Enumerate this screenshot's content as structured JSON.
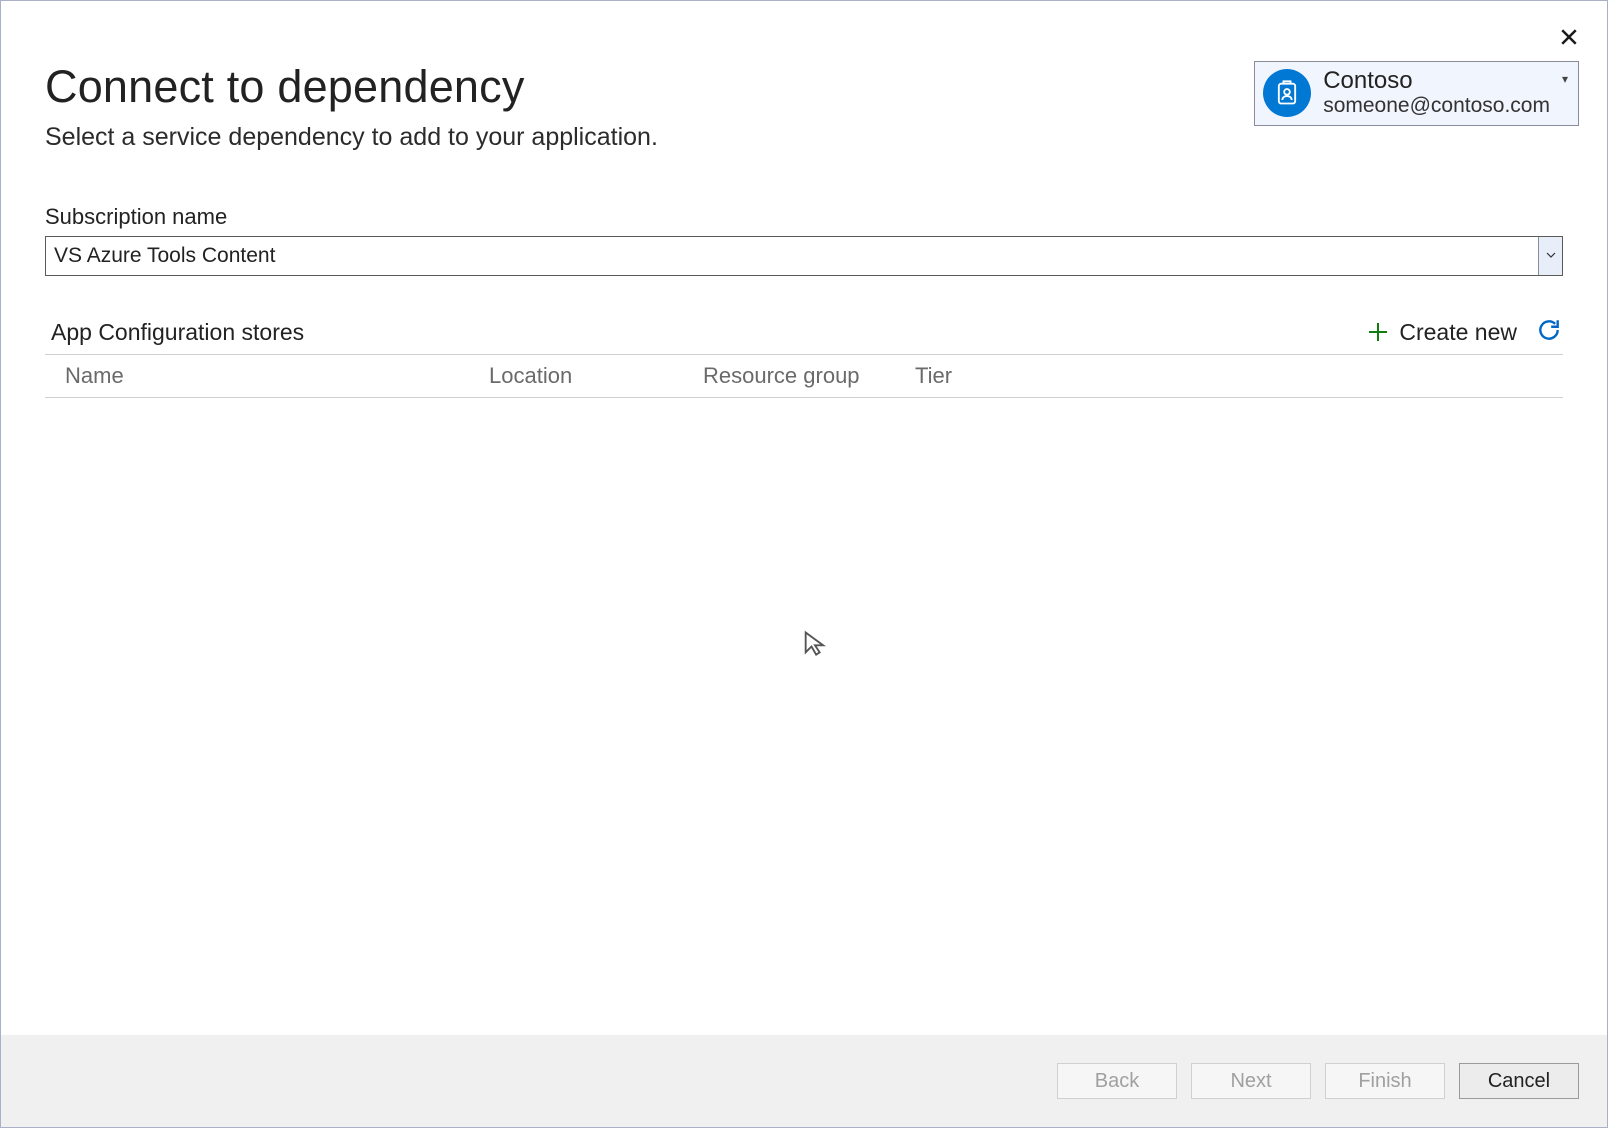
{
  "header": {
    "title": "Connect to dependency",
    "subtitle": "Select a service dependency to add to your application."
  },
  "account": {
    "org": "Contoso",
    "email": "someone@contoso.com"
  },
  "subscription": {
    "label": "Subscription name",
    "value": "VS Azure Tools Content"
  },
  "list": {
    "title": "App Configuration stores",
    "create_new": "Create new",
    "columns": {
      "name": "Name",
      "location": "Location",
      "resource_group": "Resource group",
      "tier": "Tier"
    }
  },
  "footer": {
    "back": "Back",
    "next": "Next",
    "finish": "Finish",
    "cancel": "Cancel"
  }
}
